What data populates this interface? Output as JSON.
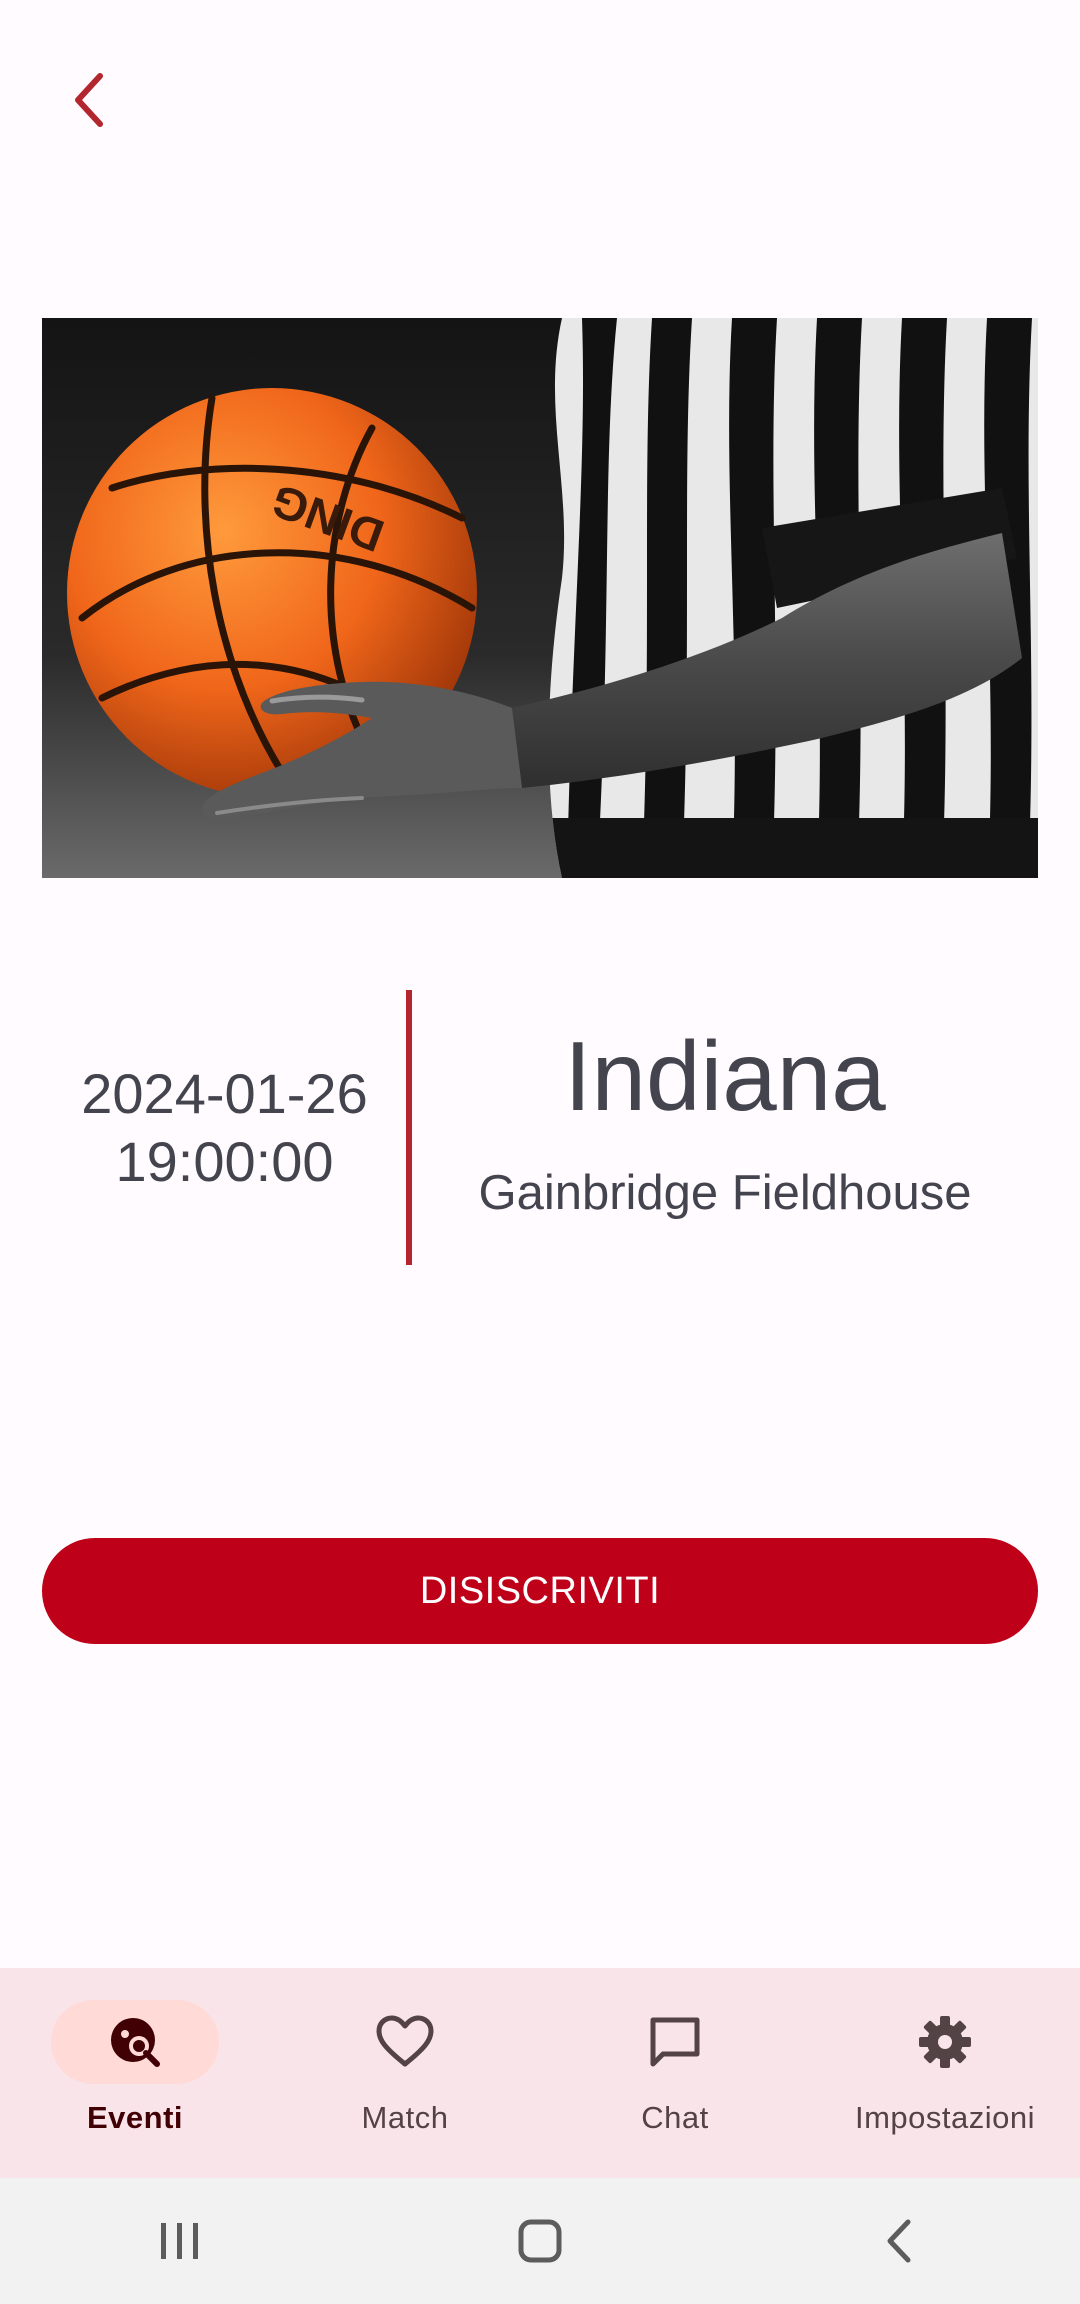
{
  "header": {
    "back_icon": "chevron-left-icon",
    "accent_color": "#b3262d"
  },
  "event": {
    "date": "2024-01-26",
    "time": "19:00:00",
    "city": "Indiana",
    "venue": "Gainbridge Fieldhouse",
    "image": "referee-holding-basketball-photo"
  },
  "actions": {
    "unsubscribe_label": "DISISCRIVITI",
    "button_color": "#bf0019"
  },
  "bottom_nav": {
    "items": [
      {
        "label": "Eventi",
        "icon": "event-search-icon",
        "active": true
      },
      {
        "label": "Match",
        "icon": "heart-icon",
        "active": false
      },
      {
        "label": "Chat",
        "icon": "chat-bubble-icon",
        "active": false
      },
      {
        "label": "Impostazioni",
        "icon": "gear-icon",
        "active": false
      }
    ]
  },
  "system_nav": {
    "recents_icon": "recents-icon",
    "home_icon": "home-icon",
    "back_icon": "back-icon"
  }
}
